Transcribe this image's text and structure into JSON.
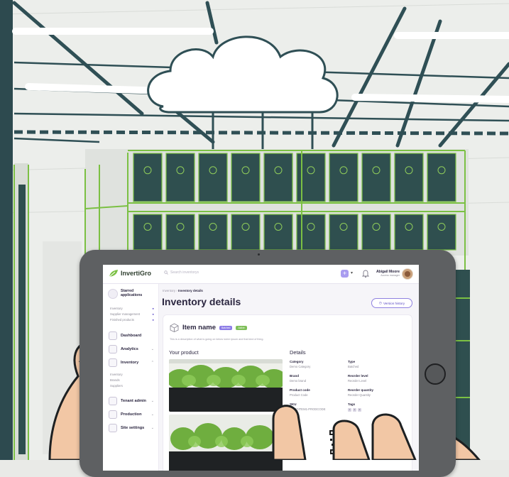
{
  "header": {
    "logo_text": "InvertiGro",
    "search_placeholder": "Search inventorys",
    "add_label": "+",
    "user_name": "Abigail Moore",
    "user_role": "Access manager"
  },
  "sidebar": {
    "starred": "Starred applications",
    "starred_subs": [
      "Inventory",
      "Supplier management",
      "Finished products"
    ],
    "items": [
      {
        "label": "Dashboard",
        "icon": "dashboard-icon"
      },
      {
        "label": "Analytics",
        "icon": "analytics-icon"
      },
      {
        "label": "Inventory",
        "icon": "inventory-icon"
      }
    ],
    "inventory_subs": [
      "Inventory",
      "Brands",
      "Suppliers"
    ],
    "items2": [
      {
        "label": "Tenant admin",
        "icon": "tenant-icon"
      },
      {
        "label": "Production",
        "icon": "production-icon"
      },
      {
        "label": "Site settings",
        "icon": "settings-icon"
      }
    ]
  },
  "breadcrumb": {
    "parent": "Inventory",
    "current": "Inventory details"
  },
  "page_title": "Inventory details",
  "version_history": "Version history",
  "item": {
    "name": "Item name",
    "badges": [
      "Batched",
      "Active"
    ],
    "description": "This is a description of what is going on below lorem ipsum and that kind of thing."
  },
  "your_product": "Your product",
  "details": {
    "title": "Details",
    "fields": [
      {
        "label": "Category",
        "value": "Demo Category"
      },
      {
        "label": "Type",
        "value": "Batched"
      },
      {
        "label": "Brand",
        "value": "Demo brand"
      },
      {
        "label": "Reorder level",
        "value": "Reorder Level"
      },
      {
        "label": "Product code",
        "value": "Product Code"
      },
      {
        "label": "Reorder quantity",
        "value": "Reorder Quantity"
      },
      {
        "label": "SKU",
        "value": "DEMOITEM1-PRODCODE"
      },
      {
        "label": "Tags",
        "value": ""
      }
    ],
    "tag_values": [
      "1",
      "2",
      "3"
    ]
  },
  "colors": {
    "accent": "#8c7ce6",
    "rack_green": "#7bc043",
    "panel": "#2f4f4f"
  }
}
